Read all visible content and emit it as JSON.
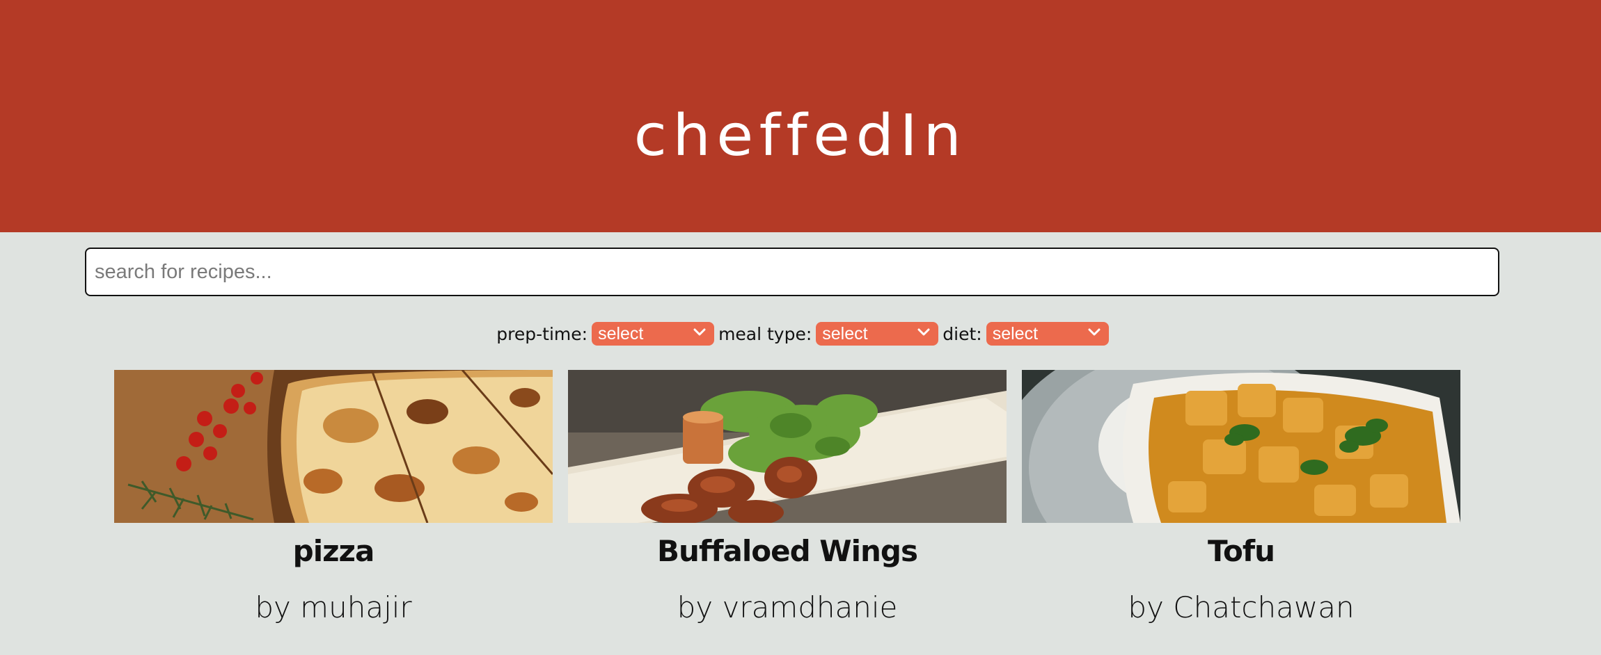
{
  "header": {
    "title": "cheffedIn",
    "background": "#b43a26"
  },
  "search": {
    "placeholder": "search for recipes...",
    "value": ""
  },
  "filters": [
    {
      "label": "prep-time:",
      "selected": "select"
    },
    {
      "label": "meal type:",
      "selected": "select"
    },
    {
      "label": "diet:",
      "selected": "select"
    }
  ],
  "accent": "#ec6a4d",
  "recipes": [
    {
      "title": "pizza",
      "author": "by muhajir",
      "image": "pizza-photo"
    },
    {
      "title": "Buffaloed Wings",
      "author": "by vramdhanie",
      "image": "wings-photo"
    },
    {
      "title": "Tofu",
      "author": "by Chatchawan",
      "image": "tofu-curry-photo"
    }
  ]
}
